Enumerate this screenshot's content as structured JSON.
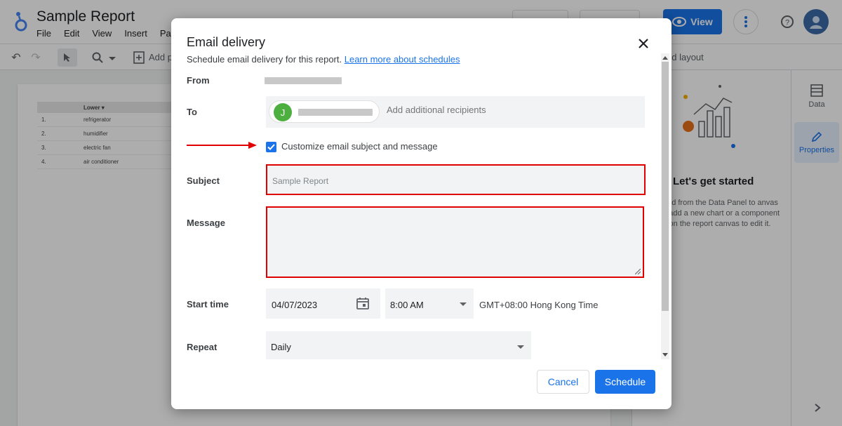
{
  "app": {
    "title": "Sample Report",
    "menu": [
      "File",
      "Edit",
      "View",
      "Insert",
      "Pa"
    ],
    "view_label": "View",
    "toolbar_add_page": "Add p",
    "toolbar_layout": "nd layout"
  },
  "canvas_table": {
    "header": "Lower",
    "rows": [
      {
        "idx": "1.",
        "value": "refrigerator"
      },
      {
        "idx": "2.",
        "value": "humidifier"
      },
      {
        "idx": "3.",
        "value": "electric fan"
      },
      {
        "idx": "4.",
        "value": "air conditioner"
      }
    ]
  },
  "right_panel": {
    "title": "Let's get started",
    "description": "field from the Data Panel to anvas to add a new chart or a component on the report canvas to edit it."
  },
  "side_rail": {
    "data_label": "Data",
    "properties_label": "Properties"
  },
  "dialog": {
    "title": "Email delivery",
    "subtitle": "Schedule email delivery for this report.",
    "learn_more": "Learn more about schedules",
    "from_label": "From",
    "to_label": "To",
    "recipient_initial": "J",
    "add_recipients_placeholder": "Add additional recipients",
    "customize_label": "Customize email subject and message",
    "customize_checked": true,
    "subject_label": "Subject",
    "subject_placeholder": "Sample Report",
    "message_label": "Message",
    "message_value": "",
    "start_time_label": "Start time",
    "start_date": "04/07/2023",
    "start_time": "8:00 AM",
    "timezone": "GMT+08:00 Hong Kong Time",
    "repeat_label": "Repeat",
    "repeat_value": "Daily",
    "cancel_label": "Cancel",
    "schedule_label": "Schedule"
  },
  "colors": {
    "accent": "#1a73e8",
    "highlight": "#e00000",
    "avatar": "#4caf3f"
  }
}
